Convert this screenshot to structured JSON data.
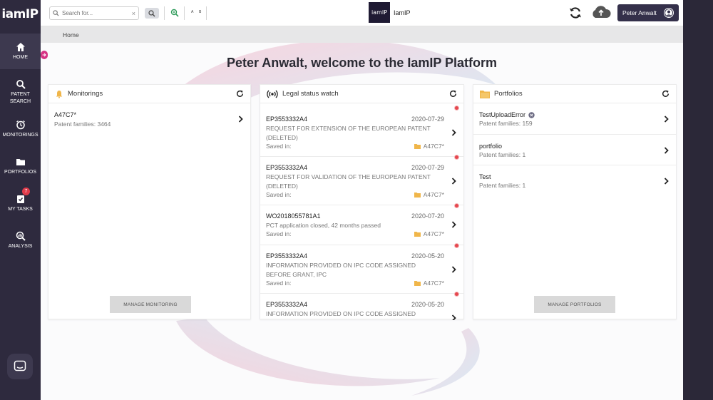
{
  "sidebar": {
    "logo": "iamIP",
    "items": [
      {
        "label": "HOME",
        "icon": "home-icon"
      },
      {
        "label": "PATENT SEARCH",
        "icon": "search-icon"
      },
      {
        "label": "MONITORINGS",
        "icon": "alarm-clock-icon"
      },
      {
        "label": "PORTFOLIOS",
        "icon": "folder-icon"
      },
      {
        "label": "MY TASKS",
        "icon": "checklist-icon",
        "badge": "7"
      },
      {
        "label": "ANALYSIS",
        "icon": "analysis-icon"
      }
    ]
  },
  "topbar": {
    "search_placeholder": "Search for...",
    "ab_label": "A B",
    "app_logo": "iamIP",
    "app_name": "IamIP",
    "user_name": "Peter Anwalt"
  },
  "breadcrumb": {
    "home": "Home"
  },
  "welcome": "Peter Anwalt, welcome to the IamIP Platform",
  "monitorings": {
    "title": "Monitorings",
    "items": [
      {
        "name": "A47C7*",
        "sub": "Patent families: 3464"
      }
    ],
    "manage_label": "MANAGE MONITORING"
  },
  "legal": {
    "title": "Legal status watch",
    "saved_label": "Saved in:",
    "items": [
      {
        "number": "EP3553332A4",
        "date": "2020-07-29",
        "desc": "REQUEST FOR EXTENSION OF THE EUROPEAN PATENT (DELETED)",
        "saved": "A47C7*"
      },
      {
        "number": "EP3553332A4",
        "date": "2020-07-29",
        "desc": "REQUEST FOR VALIDATION OF THE EUROPEAN PATENT (DELETED)",
        "saved": "A47C7*"
      },
      {
        "number": "WO2018055781A1",
        "date": "2020-07-20",
        "desc": "PCT application closed, 42 months passed",
        "saved": "A47C7*"
      },
      {
        "number": "EP3553332A4",
        "date": "2020-05-20",
        "desc": "INFORMATION PROVIDED ON IPC CODE ASSIGNED BEFORE GRANT, IPC",
        "saved": "A47C7*"
      },
      {
        "number": "EP3553332A4",
        "date": "2020-05-20",
        "desc": "INFORMATION PROVIDED ON IPC CODE ASSIGNED",
        "saved": ""
      }
    ]
  },
  "portfolios": {
    "title": "Portfolios",
    "items": [
      {
        "name": "TestUploadError",
        "sub": "Patent families: 159"
      },
      {
        "name": "portfolio",
        "sub": "Patent families: 1"
      },
      {
        "name": "Test",
        "sub": "Patent families: 1"
      }
    ],
    "manage_label": "MANAGE PORTFOLIOS"
  },
  "colors": {
    "sidebar": "#2e2a3e",
    "accent_pink": "#d63384",
    "user_button": "#34304a",
    "badge_red": "#e03b4a"
  }
}
